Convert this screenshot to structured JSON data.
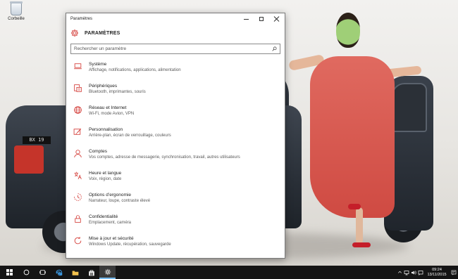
{
  "desktop": {
    "recycle_bin_label": "Corbeille",
    "plate_text": "BX 19"
  },
  "window": {
    "title": "Paramètres",
    "header": "PARAMÈTRES",
    "search_placeholder": "Rechercher un paramètre",
    "accent": "#d43f3a",
    "items": [
      {
        "icon": "laptop-icon",
        "title": "Système",
        "sub": "Affichage, notifications, applications, alimentation"
      },
      {
        "icon": "keyboard-icon",
        "title": "Périphériques",
        "sub": "Bluetooth, imprimantes, souris"
      },
      {
        "icon": "globe-icon",
        "title": "Réseau et Internet",
        "sub": "Wi-Fi, mode Avion, VPN"
      },
      {
        "icon": "paintbrush-icon",
        "title": "Personnalisation",
        "sub": "Arrière-plan, écran de verrouillage, couleurs"
      },
      {
        "icon": "person-icon",
        "title": "Comptes",
        "sub": "Vos comptes, adresse de messagerie, synchronisation, travail, autres utilisateurs"
      },
      {
        "icon": "language-icon",
        "title": "Heure et langue",
        "sub": "Voix, région, date"
      },
      {
        "icon": "ease-of-access-icon",
        "title": "Options d’ergonomie",
        "sub": "Narrateur, loupe, contraste élevé"
      },
      {
        "icon": "lock-icon",
        "title": "Confidentialité",
        "sub": "Emplacement, caméra"
      },
      {
        "icon": "refresh-icon",
        "title": "Mise à jour et sécurité",
        "sub": "Windows Update, récupération, sauvegarde"
      }
    ]
  },
  "taskbar": {
    "time": "09:24",
    "date": "13/11/2015",
    "highlight": "#76b9ed"
  }
}
